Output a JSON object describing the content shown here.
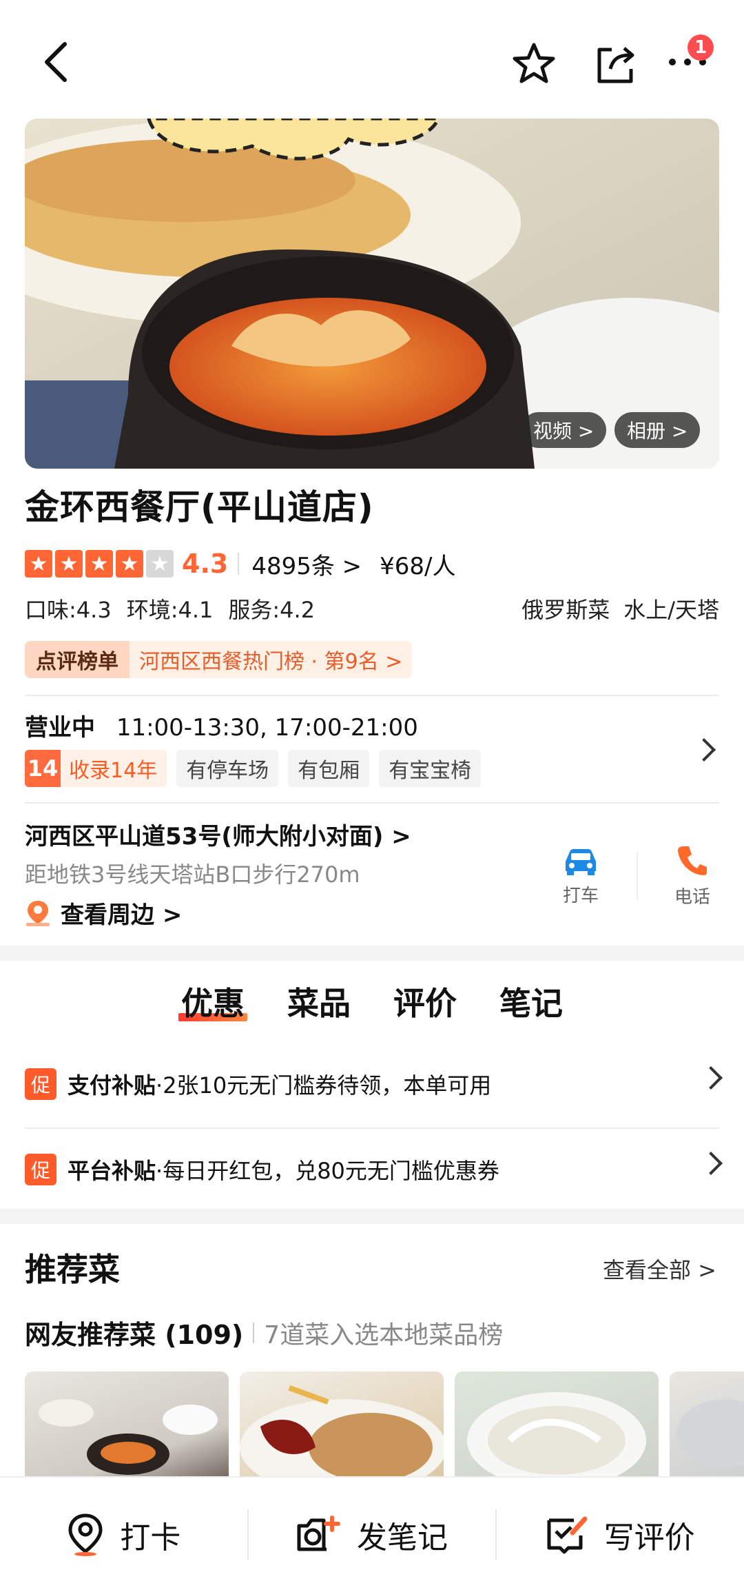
{
  "topbar": {
    "back_icon": "back-arrow-icon",
    "favorite_icon": "star-outline-icon",
    "share_icon": "share-icon",
    "more_icon": "more-dots-icon",
    "more_badge": "1"
  },
  "hero": {
    "video_label": "视频 >",
    "album_label": "相册 >"
  },
  "shop": {
    "name": "金环西餐厅(平山道店)",
    "score": "4.3",
    "stars_filled": 4,
    "reviews": "4895条 >",
    "price": "¥68/人",
    "taste": "口味:4.3",
    "environment": "环境:4.1",
    "service": "服务:4.2",
    "cuisine": "俄罗斯菜",
    "area": "水上/天塔"
  },
  "rank": {
    "tag": "点评榜单",
    "text": "河西区西餐热门榜 · 第9名 >"
  },
  "hours": {
    "status": "营业中",
    "time": "11:00-13:30, 17:00-21:00"
  },
  "features": {
    "year_num": "14",
    "year_text": "收录14年",
    "chips": [
      "有停车场",
      "有包厢",
      "有宝宝椅"
    ]
  },
  "address": {
    "line": "河西区平山道53号(师大附小对面) >",
    "metro": "距地铁3号线天塔站B口步行270m",
    "nearby": "查看周边 >",
    "taxi": "打车",
    "phone": "电话"
  },
  "tabs": [
    "优惠",
    "菜品",
    "评价",
    "笔记"
  ],
  "promos": [
    {
      "tag": "促",
      "strong": "支付补贴",
      "text": "·2张10元无门槛券待领，本单可用"
    },
    {
      "tag": "促",
      "strong": "平台补贴",
      "text": "·每日开红包，兑80元无门槛优惠券"
    }
  ],
  "recommend": {
    "title": "推荐菜",
    "see_all": "查看全部 >",
    "net_title": "网友推荐菜 (109)",
    "net_sub": "7道菜入选本地菜品榜"
  },
  "bottom": {
    "checkin": "打卡",
    "post_note": "发笔记",
    "write_review": "写评价"
  },
  "colors": {
    "accent": "#ff6633",
    "star_off": "#d8d8d8",
    "promo_tag": "#ff5a2a",
    "blue_car": "#1e88e5",
    "orange_phone": "#ff6a2a"
  }
}
